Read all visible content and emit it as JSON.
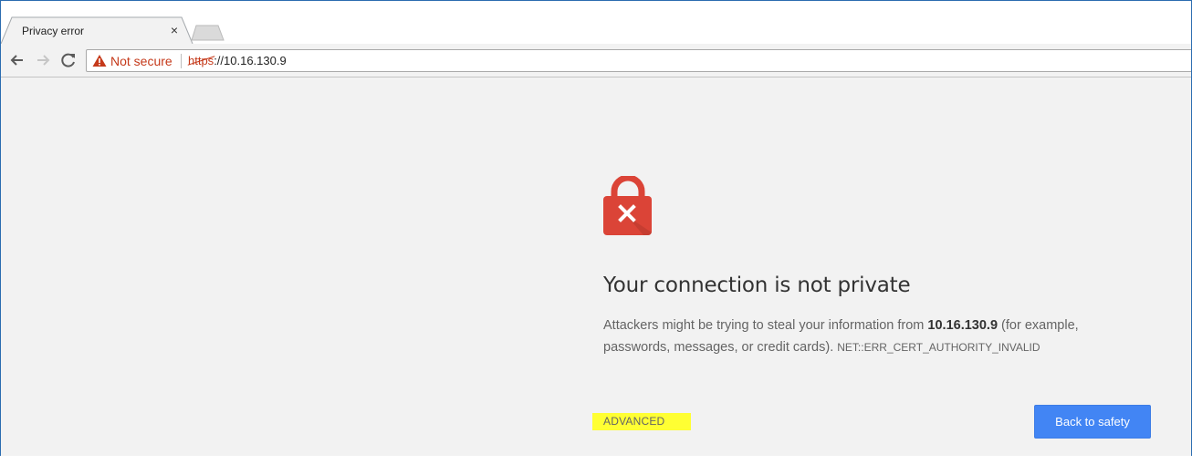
{
  "tab": {
    "title": "Privacy error",
    "close": "×"
  },
  "omnibox": {
    "security_label": "Not secure",
    "url_scheme": "https",
    "url_rest": "://10.16.130.9"
  },
  "interstitial": {
    "heading": "Your connection is not private",
    "desc_pre": "Attackers might be trying to steal your information from ",
    "host": "10.16.130.9",
    "desc_post": " (for example, passwords, messages, or credit cards). ",
    "error_code": "NET::ERR_CERT_AUTHORITY_INVALID",
    "advanced_label": "ADVANCED",
    "back_label": "Back to safety"
  },
  "colors": {
    "not_secure": "#c5391a",
    "lock_red": "#db4437",
    "primary_button": "#4285f4",
    "highlight": "#ffff33"
  },
  "icons": {
    "back": "back-arrow-icon",
    "forward": "forward-arrow-icon",
    "reload": "reload-icon",
    "warning": "warning-triangle-icon",
    "lock": "lock-error-icon",
    "new_tab": "new-tab-icon"
  }
}
